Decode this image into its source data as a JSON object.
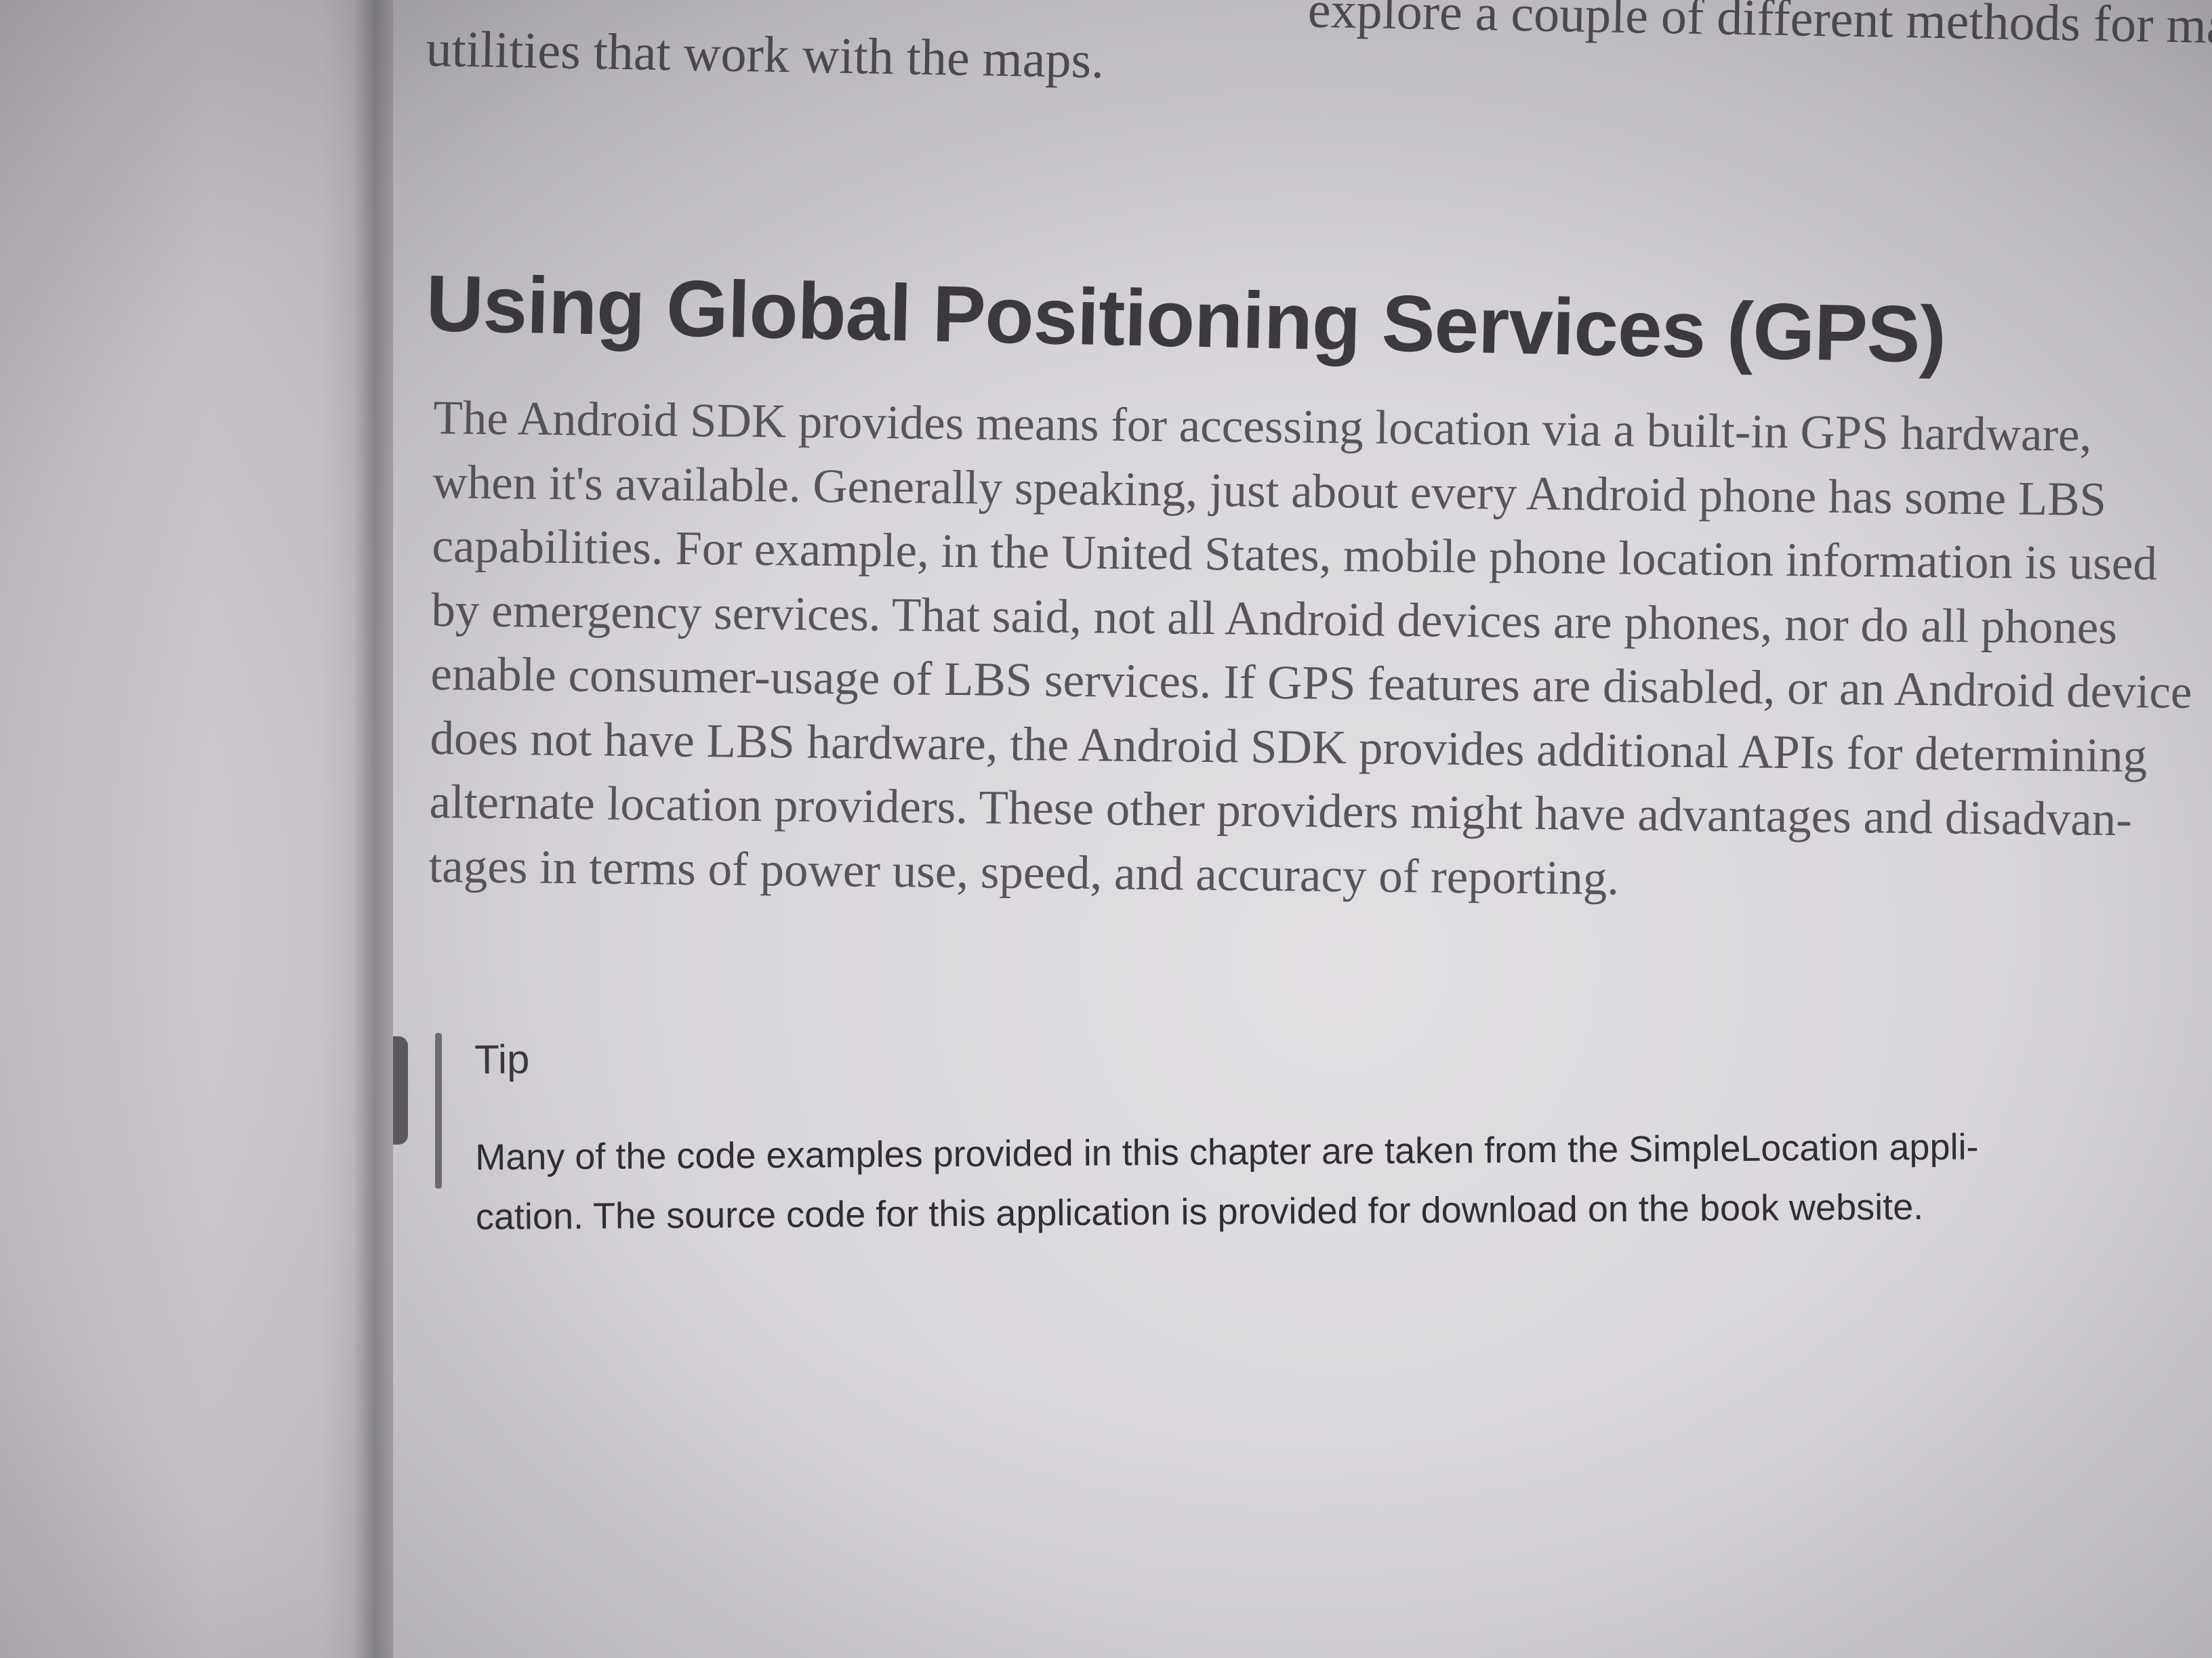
{
  "top_fragment": {
    "line1": "explore a couple of different methods for mapping an",
    "line2": "utilities that work with the maps."
  },
  "section": {
    "heading": "Using Global Positioning Services (GPS)",
    "paragraph_lines": [
      "The Android SDK provides means for accessing location via a built-in GPS hardware,",
      "when it's available. Generally speaking, just about every Android phone has some LBS",
      "capabilities. For example, in the United States, mobile phone location information is used",
      "by emergency services. That said, not all Android devices are phones, nor do all phones",
      "enable consumer-usage of LBS services. If GPS features are disabled, or an Android device",
      "does not have LBS hardware, the Android SDK provides additional APIs for determining",
      "alternate location providers. These other providers might have advantages and disadvan-",
      "tages in terms of power use, speed, and accuracy of reporting."
    ]
  },
  "tip": {
    "label": "Tip",
    "lines": [
      "Many of the code examples provided in this chapter are taken from the SimpleLocation appli-",
      "cation. The source code for this application is provided for download on the book website."
    ]
  }
}
